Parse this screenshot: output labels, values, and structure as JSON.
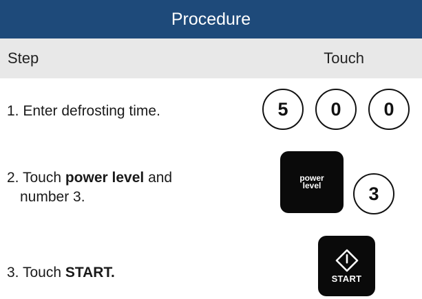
{
  "header": {
    "title": "Procedure"
  },
  "columns": {
    "step": "Step",
    "touch": "Touch"
  },
  "steps": [
    {
      "text": "1. Enter defrosting time."
    },
    {
      "prefix": "2. Touch ",
      "bold": "power level",
      "suffix": " and",
      "line2": "number 3."
    },
    {
      "prefix": "3. Touch ",
      "bold": "START."
    }
  ],
  "keys": {
    "digits_time": [
      "5",
      "0",
      "0"
    ],
    "power_level_line1": "power",
    "power_level_line2": "level",
    "digit_power": "3",
    "start": "START"
  }
}
